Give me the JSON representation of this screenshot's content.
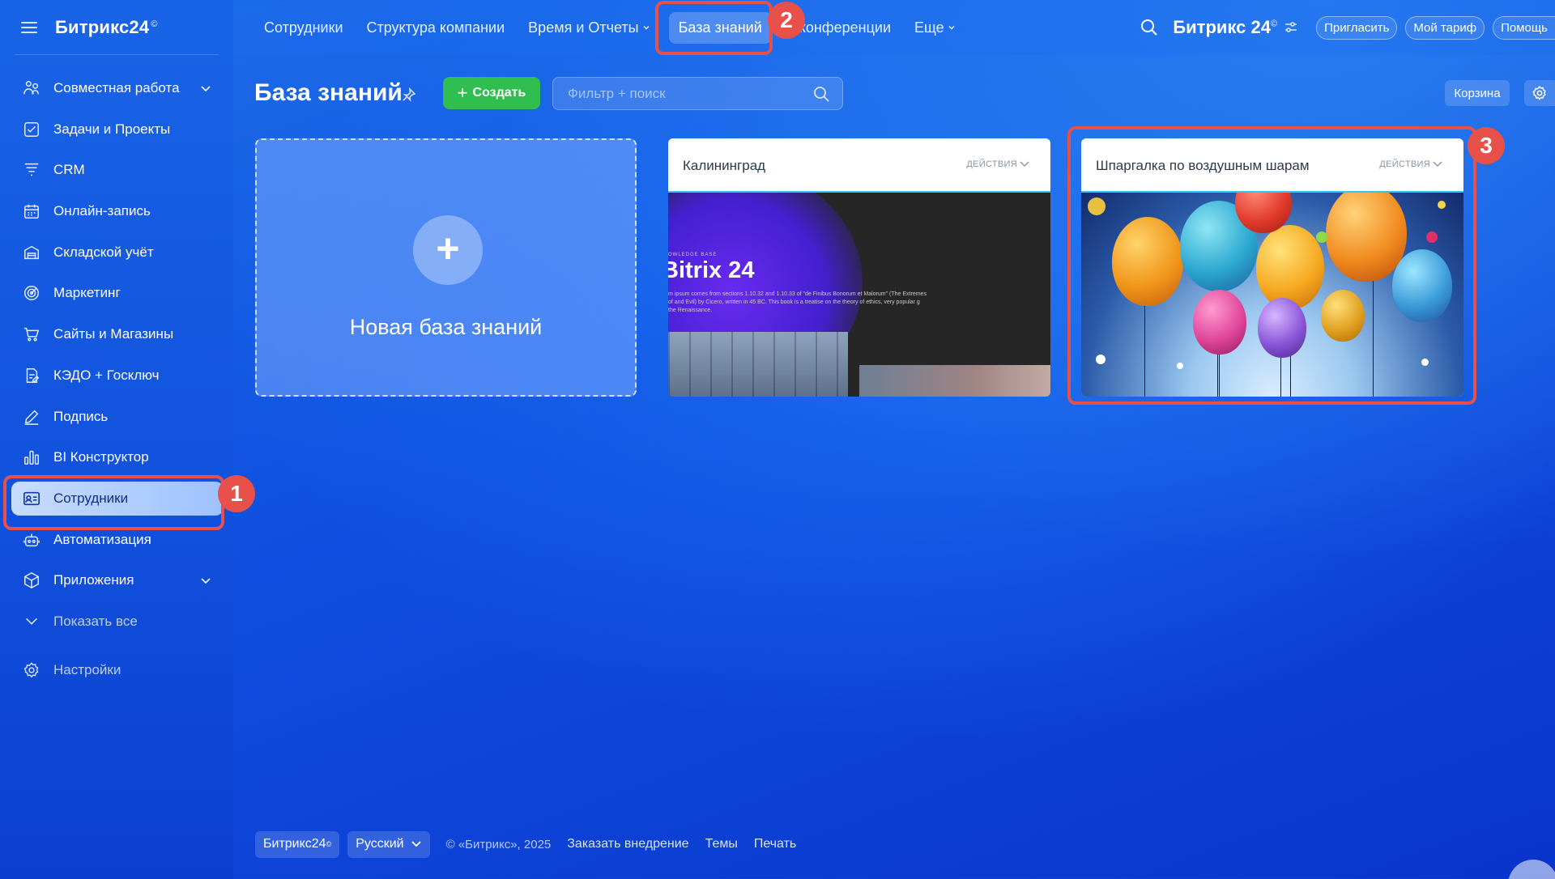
{
  "app": {
    "logo": "Битрикс24",
    "logo_mark": "©"
  },
  "sidebar": {
    "items": [
      {
        "label": "Совместная работа",
        "icon": "collab-icon",
        "has_chevron": true
      },
      {
        "label": "Задачи и Проекты",
        "icon": "tasks-icon"
      },
      {
        "label": "CRM",
        "icon": "crm-funnel-icon"
      },
      {
        "label": "Онлайн-запись",
        "icon": "calendar-icon"
      },
      {
        "label": "Складской учёт",
        "icon": "warehouse-icon"
      },
      {
        "label": "Маркетинг",
        "icon": "target-icon"
      },
      {
        "label": "Сайты и Магазины",
        "icon": "cart-icon"
      },
      {
        "label": "КЭДО + Госключ",
        "icon": "document-sign-icon"
      },
      {
        "label": "Подпись",
        "icon": "pen-icon"
      },
      {
        "label": "BI Конструктор",
        "icon": "bar-chart-icon"
      },
      {
        "label": "Сотрудники",
        "icon": "employee-card-icon",
        "active": true
      },
      {
        "label": "Автоматизация",
        "icon": "robot-icon"
      },
      {
        "label": "Приложения",
        "icon": "cube-icon",
        "has_chevron": true
      },
      {
        "label": "Показать все",
        "icon": "chevron-down-icon"
      },
      {
        "label": "Настройки",
        "icon": "gear-icon"
      }
    ]
  },
  "topnav": {
    "items": [
      "Сотрудники",
      "Структура компании",
      "Время и Отчеты",
      "База знаний",
      "еоконференции",
      "Еще"
    ],
    "active": "База знаний"
  },
  "topright": {
    "brand": "Битрикс 24",
    "brand_mark": "©",
    "invite": "Пригласить",
    "tariff": "Мой тариф",
    "help": "Помощь"
  },
  "page": {
    "title": "База знаний",
    "create_label": "Создать",
    "filter_placeholder": "Фильтр + поиск",
    "trash_label": "Корзина"
  },
  "cards": {
    "new_card_label": "Новая база знаний",
    "new_card_plus": "+",
    "actions_label": "ДЕЙСТВИЯ",
    "items": [
      {
        "title": "Калининград",
        "thumb_small": "OWLEDGE BASE",
        "thumb_title": "Bitrix 24",
        "thumb_text": "m ipsum comes from sections 1.10.32 and 1.10.33 of \"de Finibus Bonorum et Malorum\" (The Extremes of and Evil) by Cicero, written in 45 BC. This book is a treatise on the theory of ethics, very popular g the Renaissance."
      },
      {
        "title": "Шпаргалка по воздушным шарам"
      }
    ]
  },
  "markers": {
    "m1": "1",
    "m2": "2",
    "m3": "3"
  },
  "footer": {
    "brand": "Битрикс24",
    "brand_mark": "©",
    "language": "Русский",
    "copyright": "© «Битрикс», 2025",
    "order_link": "Заказать внедрение",
    "themes_link": "Темы",
    "print_link": "Печать"
  },
  "colors": {
    "accent_green": "#2fbe4f",
    "highlight_red": "#e8504a",
    "card_border_cyan": "#2fc6f6"
  }
}
